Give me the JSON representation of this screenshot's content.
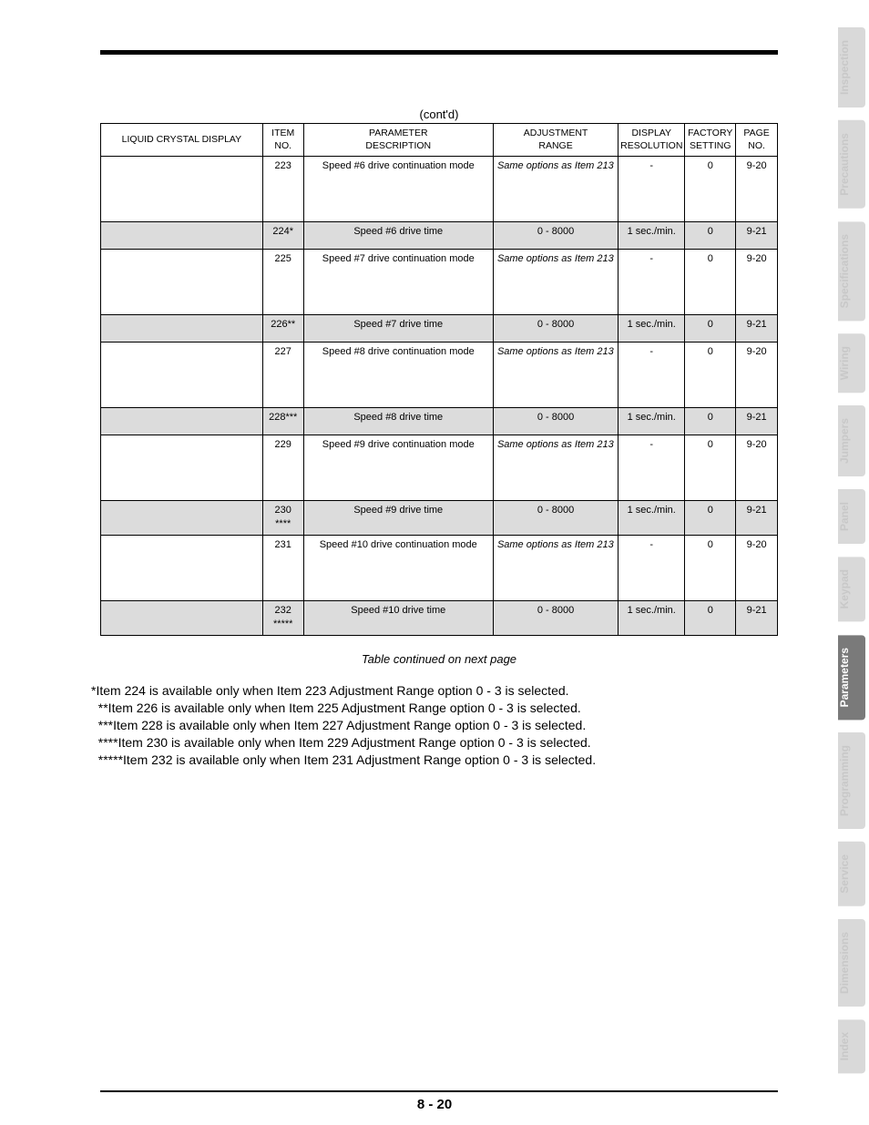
{
  "contd_label": "(cont'd)",
  "headers": {
    "lcd": "LIQUID CRYSTAL DISPLAY",
    "item_no_1": "ITEM",
    "item_no_2": "NO.",
    "desc_1": "PARAMETER",
    "desc_2": "DESCRIPTION",
    "adj_1": "ADJUSTMENT",
    "adj_2": "RANGE",
    "res_1": "DISPLAY",
    "res_2": "RESOLUTION",
    "fac_1": "FACTORY",
    "fac_2": "SETTING",
    "page_1": "PAGE",
    "page_2": "NO."
  },
  "rows": [
    {
      "shaded": false,
      "height": "tall",
      "lcd": "",
      "item": "223",
      "desc": "Speed #6 drive continuation mode",
      "adj_italic": true,
      "adj": "Same options as Item 213",
      "res": "-",
      "fac": "0",
      "page": "9-20"
    },
    {
      "shaded": true,
      "height": "short",
      "lcd": "",
      "item": "224*",
      "desc": "Speed #6 drive time",
      "adj_italic": false,
      "adj": "0 - 8000",
      "res": "1 sec./min.",
      "fac": "0",
      "page": "9-21"
    },
    {
      "shaded": false,
      "height": "tall",
      "lcd": "",
      "item": "225",
      "desc": "Speed #7 drive continuation mode",
      "adj_italic": true,
      "adj": "Same options as Item 213",
      "res": "-",
      "fac": "0",
      "page": "9-20"
    },
    {
      "shaded": true,
      "height": "short",
      "lcd": "",
      "item": "226**",
      "desc": "Speed #7 drive time",
      "adj_italic": false,
      "adj": "0 - 8000",
      "res": "1 sec./min.",
      "fac": "0",
      "page": "9-21"
    },
    {
      "shaded": false,
      "height": "tall",
      "lcd": "",
      "item": "227",
      "desc": "Speed #8 drive continuation mode",
      "adj_italic": true,
      "adj": "Same options as Item 213",
      "res": "-",
      "fac": "0",
      "page": "9-20"
    },
    {
      "shaded": true,
      "height": "short",
      "lcd": "",
      "item": "228***",
      "desc": "Speed #8 drive time",
      "adj_italic": false,
      "adj": "0 - 8000",
      "res": "1 sec./min.",
      "fac": "0",
      "page": "9-21"
    },
    {
      "shaded": false,
      "height": "tall",
      "lcd": "",
      "item": "229",
      "desc": "Speed #9 drive continuation mode",
      "adj_italic": true,
      "adj": "Same options as Item 213",
      "res": "-",
      "fac": "0",
      "page": "9-20"
    },
    {
      "shaded": true,
      "height": "shortplus",
      "lcd": "",
      "item": "230 ****",
      "desc": "Speed #9 drive time",
      "adj_italic": false,
      "adj": "0 - 8000",
      "res": "1 sec./min.",
      "fac": "0",
      "page": "9-21"
    },
    {
      "shaded": false,
      "height": "tall",
      "lcd": "",
      "item": "231",
      "desc": "Speed #10 drive continuation mode",
      "adj_italic": true,
      "adj": "Same options as Item 213",
      "res": "-",
      "fac": "0",
      "page": "9-20"
    },
    {
      "shaded": true,
      "height": "shortplus",
      "lcd": "",
      "item": "232 *****",
      "desc": "Speed #10 drive time",
      "adj_italic": false,
      "adj": "0 - 8000",
      "res": "1 sec./min.",
      "fac": "0",
      "page": "9-21"
    }
  ],
  "table_note": "Table continued on next page",
  "footnotes": [
    "*Item 224 is available only when Item 223 Adjustment Range option 0 - 3 is selected.",
    "  **Item 226 is available only when Item 225 Adjustment Range option 0 - 3 is selected.",
    "  ***Item 228 is available only when Item 227 Adjustment Range option 0 - 3 is selected.",
    "  ****Item 230 is available only when Item 229 Adjustment Range option 0 - 3 is selected.",
    "  *****Item 232 is available only when Item 231 Adjustment Range option 0 - 3 is selected."
  ],
  "page_number": "8 - 20",
  "tabs": [
    {
      "label": "Inspection",
      "active": false
    },
    {
      "label": "Precautions",
      "active": false
    },
    {
      "label": "Specifications",
      "active": false
    },
    {
      "label": "Wiring",
      "active": false
    },
    {
      "label": "Jumpers",
      "active": false
    },
    {
      "label": "Panel",
      "active": false
    },
    {
      "label": "Keypad",
      "active": false
    },
    {
      "label": "Parameters",
      "active": true
    },
    {
      "label": "Programming",
      "active": false
    },
    {
      "label": "Service",
      "active": false
    },
    {
      "label": "Dimensions",
      "active": false
    },
    {
      "label": "Index",
      "active": false
    }
  ]
}
